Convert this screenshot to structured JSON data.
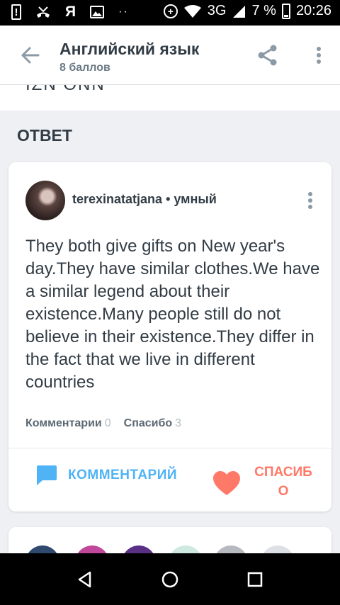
{
  "status_bar": {
    "carrier_glyph": "Я",
    "network": "3G",
    "battery": "7 %",
    "time": "20:26"
  },
  "app_bar": {
    "title": "Английский язык",
    "subtitle": "8 баллов"
  },
  "question_cut_text": "IZN  ONN",
  "answer_section": {
    "title": "ОТВЕТ",
    "author": "terexinatatjana",
    "separator": " • ",
    "rank": "умный",
    "text": "They both give gifts on New year's day.They have similar clothes.We have a similar legend about their existence.Many people still do not believe in their existence.They differ in the fact that we live in different countries",
    "comments_label": "Комментарии",
    "comments_count": "0",
    "thanks_label": "Спасибо",
    "thanks_count": "3",
    "comment_button": "КОММЕНТАРИЙ",
    "thanks_button": "СПАСИБО"
  },
  "colors": {
    "accent_blue": "#4fb3f6",
    "accent_red": "#ff7968",
    "text_dark": "#323c45",
    "background": "#eef0f4"
  },
  "icons": [
    "back-arrow-icon",
    "share-icon",
    "more-vertical-icon",
    "comment-bubble-icon",
    "heart-icon",
    "nav-back-icon",
    "nav-home-icon",
    "nav-recents-icon"
  ]
}
